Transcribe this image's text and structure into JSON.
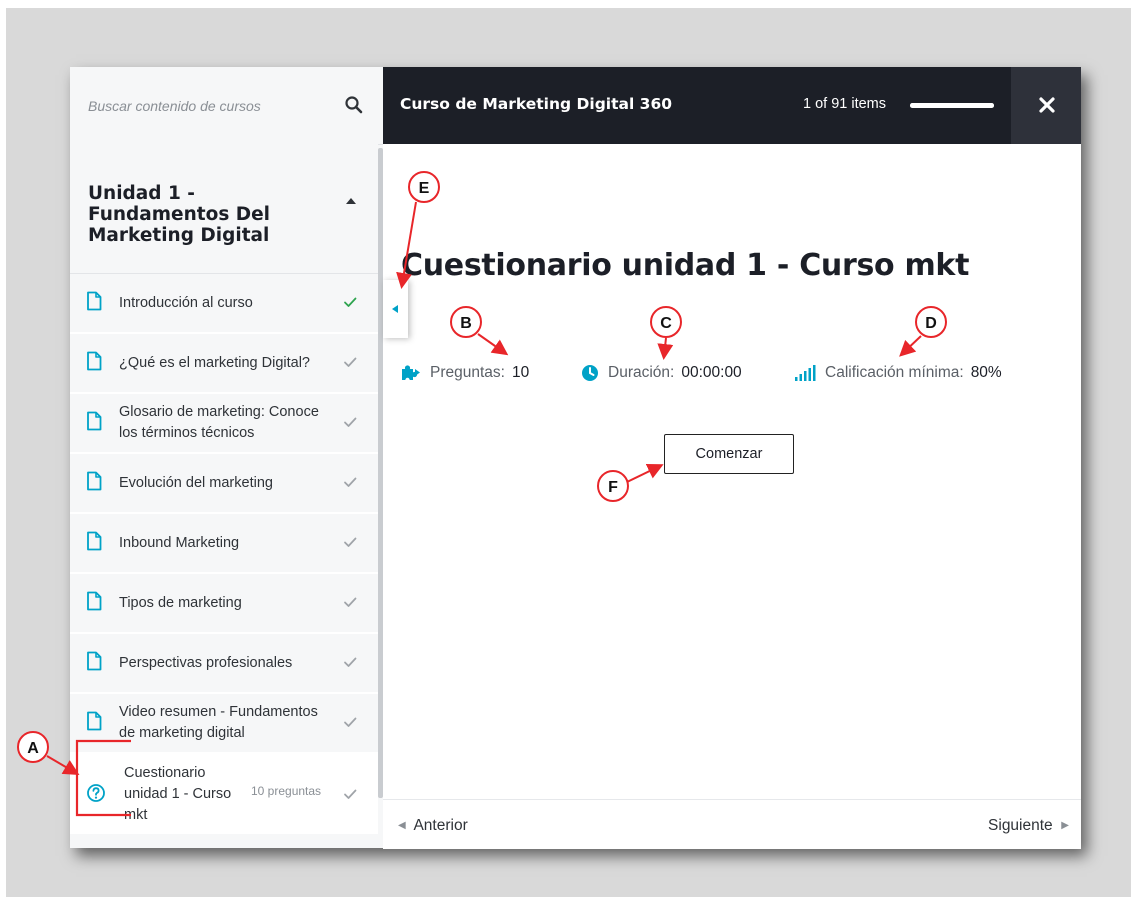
{
  "sidebar": {
    "search_placeholder": "Buscar contenido de cursos",
    "section_title": "Unidad 1 - Fundamentos Del Marketing Digital",
    "lessons": [
      {
        "title": "Introducción al curso",
        "icon": "file-icon",
        "completed": true,
        "check_color": "#2ea44f"
      },
      {
        "title": "¿Qué es el marketing Digital?",
        "icon": "file-icon",
        "completed": true,
        "check_color": "#a0a4a9"
      },
      {
        "title": "Glosario de marketing: Conoce los términos técnicos",
        "icon": "file-icon",
        "completed": true,
        "check_color": "#a0a4a9"
      },
      {
        "title": "Evolución del marketing",
        "icon": "file-icon",
        "completed": true,
        "check_color": "#a0a4a9"
      },
      {
        "title": "Inbound Marketing",
        "icon": "file-icon",
        "completed": true,
        "check_color": "#a0a4a9"
      },
      {
        "title": "Tipos de marketing",
        "icon": "file-icon",
        "completed": true,
        "check_color": "#a0a4a9"
      },
      {
        "title": "Perspectivas profesionales",
        "icon": "file-icon",
        "completed": true,
        "check_color": "#a0a4a9"
      },
      {
        "title": "Video resumen - Fundamentos de marketing digital",
        "icon": "file-icon",
        "completed": true,
        "check_color": "#a0a4a9"
      },
      {
        "title": "Cuestionario unidad 1 - Curso mkt",
        "icon": "question-circle-icon",
        "meta": "10 preguntas",
        "completed": true,
        "current": true,
        "check_color": "#a0a4a9"
      }
    ]
  },
  "header": {
    "course_title": "Curso de Marketing Digital 360",
    "items_count": "1 of 91 items",
    "progress_fraction": 1.0
  },
  "quiz": {
    "title": "Cuestionario unidad 1 - Curso mkt",
    "questions_label": "Preguntas:",
    "questions_value": "10",
    "duration_label": "Duración:",
    "duration_value": "00:00:00",
    "min_grade_label": "Calificación mínima:",
    "min_grade_value": "80%",
    "start_label": "Comenzar"
  },
  "footer": {
    "prev_label": "Anterior",
    "next_label": "Siguiente"
  },
  "annotations": {
    "letters": [
      "A",
      "B",
      "C",
      "D",
      "E",
      "F"
    ],
    "color": "#e8262a"
  },
  "colors": {
    "accent": "#00a2c7",
    "dark_bar": "#1c1f27",
    "close_bg": "#2e313a",
    "check_done": "#2ea44f"
  }
}
